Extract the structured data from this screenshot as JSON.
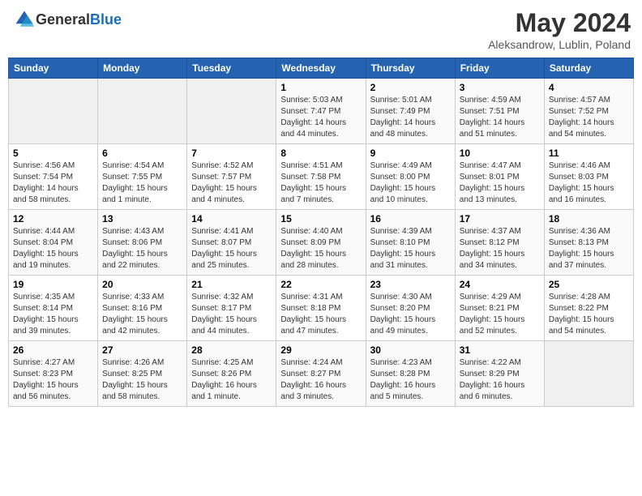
{
  "header": {
    "logo_general": "General",
    "logo_blue": "Blue",
    "month_year": "May 2024",
    "location": "Aleksandrow, Lublin, Poland"
  },
  "days_of_week": [
    "Sunday",
    "Monday",
    "Tuesday",
    "Wednesday",
    "Thursday",
    "Friday",
    "Saturday"
  ],
  "weeks": [
    [
      {
        "day": "",
        "info": ""
      },
      {
        "day": "",
        "info": ""
      },
      {
        "day": "",
        "info": ""
      },
      {
        "day": "1",
        "info": "Sunrise: 5:03 AM\nSunset: 7:47 PM\nDaylight: 14 hours\nand 44 minutes."
      },
      {
        "day": "2",
        "info": "Sunrise: 5:01 AM\nSunset: 7:49 PM\nDaylight: 14 hours\nand 48 minutes."
      },
      {
        "day": "3",
        "info": "Sunrise: 4:59 AM\nSunset: 7:51 PM\nDaylight: 14 hours\nand 51 minutes."
      },
      {
        "day": "4",
        "info": "Sunrise: 4:57 AM\nSunset: 7:52 PM\nDaylight: 14 hours\nand 54 minutes."
      }
    ],
    [
      {
        "day": "5",
        "info": "Sunrise: 4:56 AM\nSunset: 7:54 PM\nDaylight: 14 hours\nand 58 minutes."
      },
      {
        "day": "6",
        "info": "Sunrise: 4:54 AM\nSunset: 7:55 PM\nDaylight: 15 hours\nand 1 minute."
      },
      {
        "day": "7",
        "info": "Sunrise: 4:52 AM\nSunset: 7:57 PM\nDaylight: 15 hours\nand 4 minutes."
      },
      {
        "day": "8",
        "info": "Sunrise: 4:51 AM\nSunset: 7:58 PM\nDaylight: 15 hours\nand 7 minutes."
      },
      {
        "day": "9",
        "info": "Sunrise: 4:49 AM\nSunset: 8:00 PM\nDaylight: 15 hours\nand 10 minutes."
      },
      {
        "day": "10",
        "info": "Sunrise: 4:47 AM\nSunset: 8:01 PM\nDaylight: 15 hours\nand 13 minutes."
      },
      {
        "day": "11",
        "info": "Sunrise: 4:46 AM\nSunset: 8:03 PM\nDaylight: 15 hours\nand 16 minutes."
      }
    ],
    [
      {
        "day": "12",
        "info": "Sunrise: 4:44 AM\nSunset: 8:04 PM\nDaylight: 15 hours\nand 19 minutes."
      },
      {
        "day": "13",
        "info": "Sunrise: 4:43 AM\nSunset: 8:06 PM\nDaylight: 15 hours\nand 22 minutes."
      },
      {
        "day": "14",
        "info": "Sunrise: 4:41 AM\nSunset: 8:07 PM\nDaylight: 15 hours\nand 25 minutes."
      },
      {
        "day": "15",
        "info": "Sunrise: 4:40 AM\nSunset: 8:09 PM\nDaylight: 15 hours\nand 28 minutes."
      },
      {
        "day": "16",
        "info": "Sunrise: 4:39 AM\nSunset: 8:10 PM\nDaylight: 15 hours\nand 31 minutes."
      },
      {
        "day": "17",
        "info": "Sunrise: 4:37 AM\nSunset: 8:12 PM\nDaylight: 15 hours\nand 34 minutes."
      },
      {
        "day": "18",
        "info": "Sunrise: 4:36 AM\nSunset: 8:13 PM\nDaylight: 15 hours\nand 37 minutes."
      }
    ],
    [
      {
        "day": "19",
        "info": "Sunrise: 4:35 AM\nSunset: 8:14 PM\nDaylight: 15 hours\nand 39 minutes."
      },
      {
        "day": "20",
        "info": "Sunrise: 4:33 AM\nSunset: 8:16 PM\nDaylight: 15 hours\nand 42 minutes."
      },
      {
        "day": "21",
        "info": "Sunrise: 4:32 AM\nSunset: 8:17 PM\nDaylight: 15 hours\nand 44 minutes."
      },
      {
        "day": "22",
        "info": "Sunrise: 4:31 AM\nSunset: 8:18 PM\nDaylight: 15 hours\nand 47 minutes."
      },
      {
        "day": "23",
        "info": "Sunrise: 4:30 AM\nSunset: 8:20 PM\nDaylight: 15 hours\nand 49 minutes."
      },
      {
        "day": "24",
        "info": "Sunrise: 4:29 AM\nSunset: 8:21 PM\nDaylight: 15 hours\nand 52 minutes."
      },
      {
        "day": "25",
        "info": "Sunrise: 4:28 AM\nSunset: 8:22 PM\nDaylight: 15 hours\nand 54 minutes."
      }
    ],
    [
      {
        "day": "26",
        "info": "Sunrise: 4:27 AM\nSunset: 8:23 PM\nDaylight: 15 hours\nand 56 minutes."
      },
      {
        "day": "27",
        "info": "Sunrise: 4:26 AM\nSunset: 8:25 PM\nDaylight: 15 hours\nand 58 minutes."
      },
      {
        "day": "28",
        "info": "Sunrise: 4:25 AM\nSunset: 8:26 PM\nDaylight: 16 hours\nand 1 minute."
      },
      {
        "day": "29",
        "info": "Sunrise: 4:24 AM\nSunset: 8:27 PM\nDaylight: 16 hours\nand 3 minutes."
      },
      {
        "day": "30",
        "info": "Sunrise: 4:23 AM\nSunset: 8:28 PM\nDaylight: 16 hours\nand 5 minutes."
      },
      {
        "day": "31",
        "info": "Sunrise: 4:22 AM\nSunset: 8:29 PM\nDaylight: 16 hours\nand 6 minutes."
      },
      {
        "day": "",
        "info": ""
      }
    ]
  ]
}
